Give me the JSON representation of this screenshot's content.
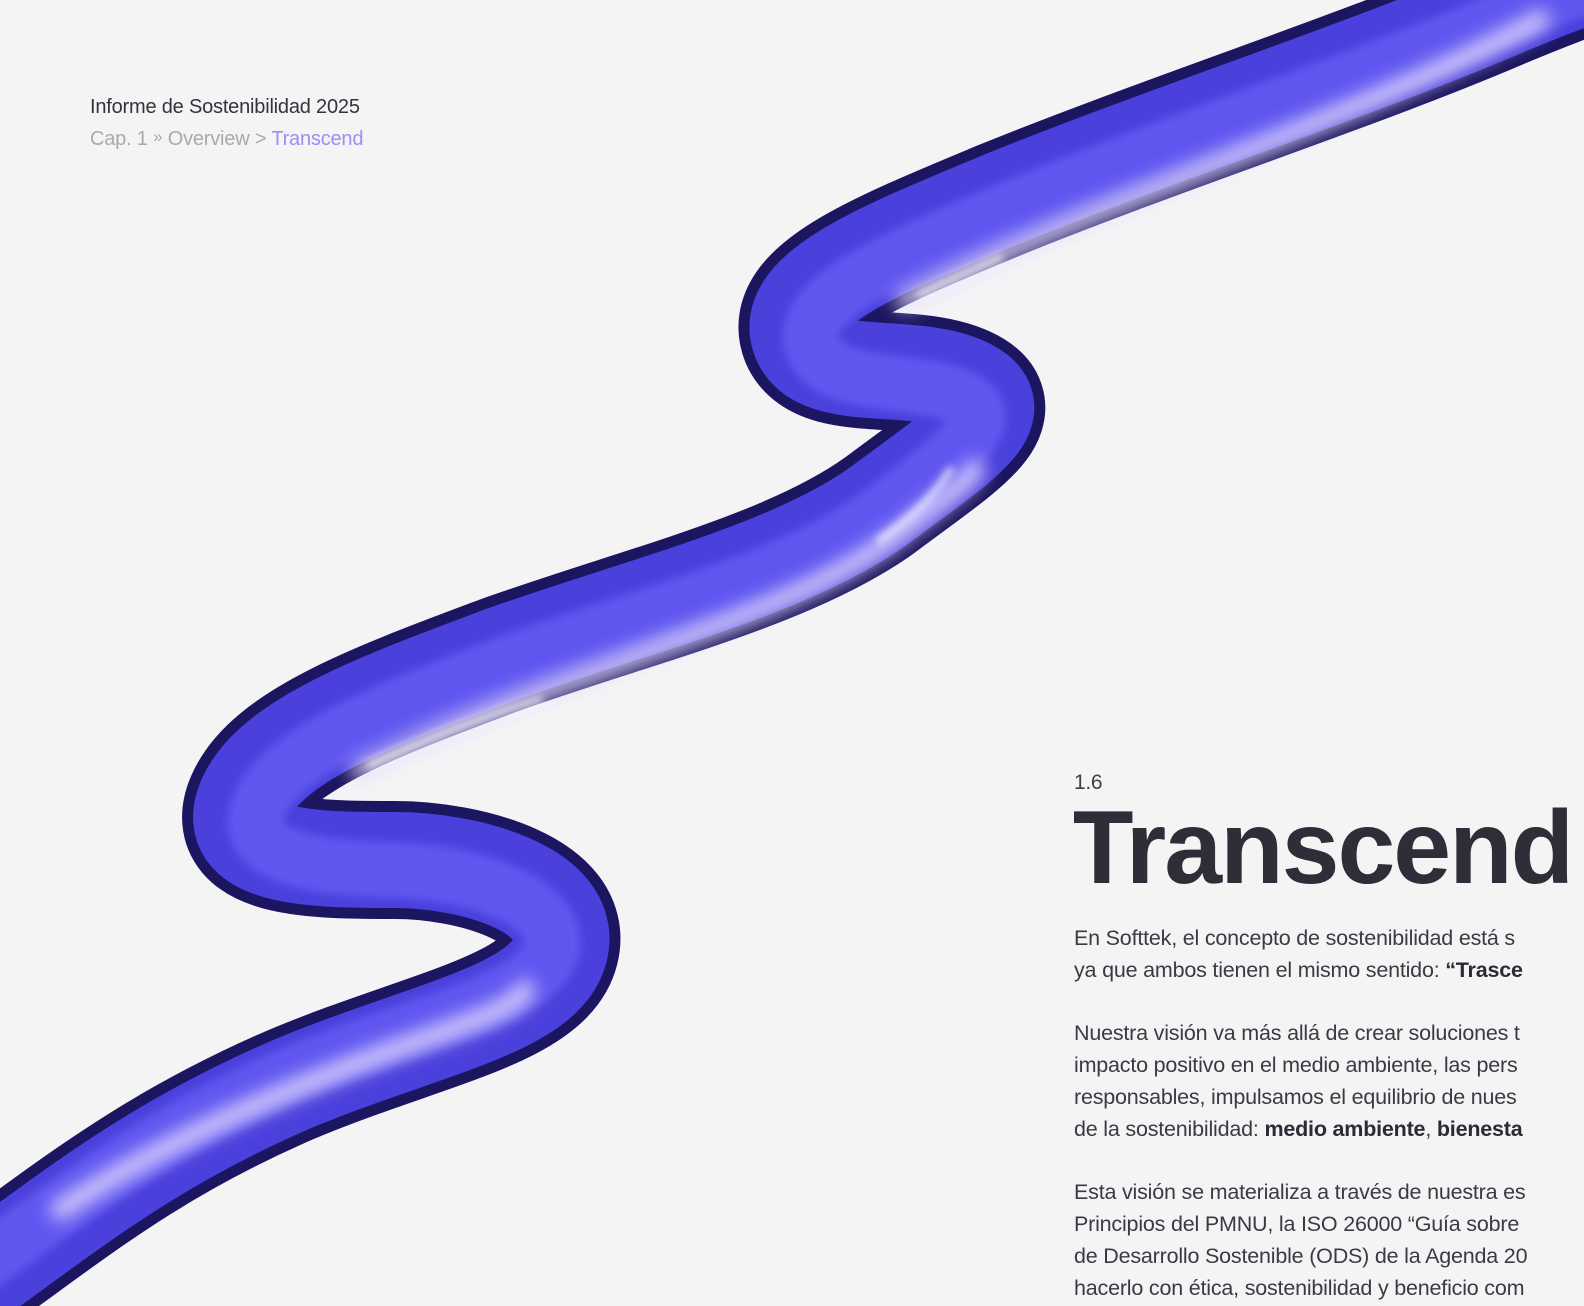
{
  "header": {
    "report_title": "Informe de Sostenibilidad 2025",
    "breadcrumb": {
      "chapter": "Cap. 1",
      "sep1": "»",
      "section": "Overview",
      "sep2": ">",
      "current": "Transcend"
    }
  },
  "content": {
    "section_number": "1.6",
    "title": "Transcend",
    "paragraphs": [
      {
        "lines": [
          {
            "text": "En Softtek, el concepto de sostenibilidad está s"
          },
          {
            "text": "ya que ambos tienen el mismo sentido: ",
            "bold": "“Trasce"
          }
        ]
      },
      {
        "lines": [
          {
            "text": "Nuestra visión va más allá de crear soluciones t"
          },
          {
            "text": "impacto positivo en el medio ambiente, las pers"
          },
          {
            "text": "responsables, impulsamos el equilibrio de nues"
          },
          {
            "text": "de la sostenibilidad: ",
            "bold": "medio ambiente",
            "after": ", ",
            "bold2": "bienesta"
          }
        ]
      },
      {
        "lines": [
          {
            "text": "Esta visión se materializa a través de nuestra es"
          },
          {
            "text": "Principios del PMNU, la ISO 26000 “Guía sobre"
          },
          {
            "text": "de Desarrollo Sostenible (ODS) de la Agenda 20"
          },
          {
            "text": "hacerlo con ética, sostenibilidad y beneficio com"
          }
        ]
      }
    ]
  },
  "colors": {
    "background": "#f4f4f5",
    "ribbon_base": "#5148e8",
    "ribbon_dark": "#1c1660",
    "ribbon_highlight": "#ece6ff",
    "breadcrumb_current": "#9b8ff2",
    "title_text": "#2e2e39"
  }
}
